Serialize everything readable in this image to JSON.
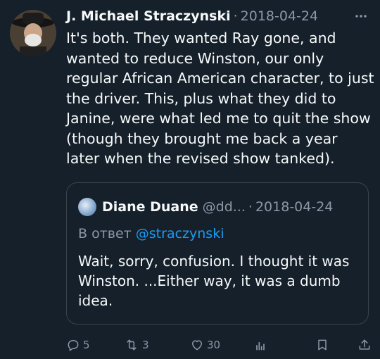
{
  "tweet": {
    "author_name": "J. Michael Straczynski",
    "separator": "·",
    "date": "2018-04-24",
    "text": "It's both.  They wanted Ray gone, and wanted to reduce Winston, our only regular African American character, to just the driver.  This, plus what they did to Janine, were what led me to quit the show (though they brought me back a year later when the revised show tanked).",
    "more_icon": "more-horizontal-icon"
  },
  "quoted_tweet": {
    "author_name": "Diane Duane",
    "handle": "@dd...",
    "separator": "·",
    "date": "2018-04-24",
    "reply_prefix": "В ответ",
    "reply_to": "@straczynski",
    "text": "Wait, sorry, confusion. I thought it was Winston. ...Either way, it was a dumb idea."
  },
  "actions": {
    "reply_count": "5",
    "retweet_count": "3",
    "like_count": "30",
    "icons": [
      "reply-icon",
      "retweet-icon",
      "like-icon",
      "views-icon",
      "bookmark-icon",
      "share-icon"
    ]
  },
  "colors": {
    "background": "#15202b",
    "text": "#f7f9f9",
    "secondary": "#8b98a5",
    "accent": "#1d9bf0",
    "border": "#38444d"
  }
}
